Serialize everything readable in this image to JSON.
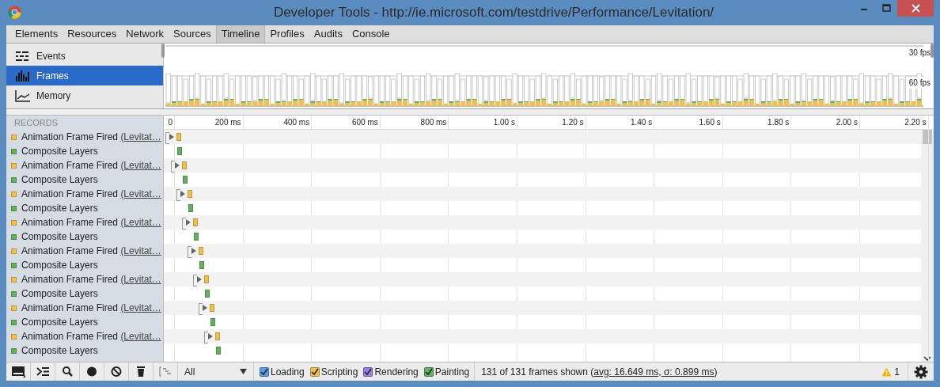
{
  "window": {
    "title": "Developer Tools - http://ie.microsoft.com/testdrive/Performance/Levitation/"
  },
  "tabs": [
    {
      "label": "Elements",
      "selected": false
    },
    {
      "label": "Resources",
      "selected": false
    },
    {
      "label": "Network",
      "selected": false
    },
    {
      "label": "Sources",
      "selected": false
    },
    {
      "label": "Timeline",
      "selected": true
    },
    {
      "label": "Profiles",
      "selected": false
    },
    {
      "label": "Audits",
      "selected": false
    },
    {
      "label": "Console",
      "selected": false
    }
  ],
  "overview_modes": [
    {
      "kind": "events",
      "label": "Events",
      "selected": false
    },
    {
      "kind": "frames",
      "label": "Frames",
      "selected": true
    },
    {
      "kind": "memory",
      "label": "Memory",
      "selected": false
    }
  ],
  "overview": {
    "labels": [
      "30 fps",
      "60 fps"
    ]
  },
  "records": {
    "header": "RECORDS",
    "ticks": [
      "0",
      "200 ms",
      "400 ms",
      "600 ms",
      "800 ms",
      "1.00 s",
      "1.20 s",
      "1.40 s",
      "1.60 s",
      "1.80 s",
      "2.00 s",
      "2.20 s"
    ],
    "rows": [
      {
        "label": "Animation Frame Fired",
        "link": "(Levitat…",
        "color": "#f0c04a",
        "expanded": false
      },
      {
        "label": "Composite Layers",
        "color": "#64b060"
      },
      {
        "label": "Animation Frame Fired",
        "link": "(Levitat…",
        "color": "#f0c04a",
        "expanded": false
      },
      {
        "label": "Composite Layers",
        "color": "#64b060"
      },
      {
        "label": "Animation Frame Fired",
        "link": "(Levitat…",
        "color": "#f0c04a",
        "expanded": false
      },
      {
        "label": "Composite Layers",
        "color": "#64b060"
      },
      {
        "label": "Animation Frame Fired",
        "link": "(Levitat…",
        "color": "#f0c04a",
        "expanded": false
      },
      {
        "label": "Composite Layers",
        "color": "#64b060"
      },
      {
        "label": "Animation Frame Fired",
        "link": "(Levitat…",
        "color": "#f0c04a",
        "expanded": false
      },
      {
        "label": "Composite Layers",
        "color": "#64b060"
      },
      {
        "label": "Animation Frame Fired",
        "link": "(Levitat…",
        "color": "#f0c04a",
        "expanded": false
      },
      {
        "label": "Composite Layers",
        "color": "#64b060"
      },
      {
        "label": "Animation Frame Fired",
        "link": "(Levitat…",
        "color": "#f0c04a",
        "expanded": false
      },
      {
        "label": "Composite Layers",
        "color": "#64b060"
      },
      {
        "label": "Animation Frame Fired",
        "link": "(Levitat…",
        "color": "#f0c04a",
        "expanded": false
      },
      {
        "label": "Composite Layers",
        "color": "#64b060"
      }
    ]
  },
  "status_bar": {
    "filter": "All",
    "categories": [
      {
        "label": "Loading",
        "checked": true,
        "color": "#5a9ce6"
      },
      {
        "label": "Scripting",
        "checked": true,
        "color": "#f0c04a"
      },
      {
        "label": "Rendering",
        "checked": true,
        "color": "#9b7fe6"
      },
      {
        "label": "Painting",
        "checked": true,
        "color": "#64b060"
      }
    ],
    "summary": "131 of 131 frames shown (",
    "summary_link": "avg: 16.649 ms, σ: 0.899 ms",
    "summary_end": ")",
    "warnings": "1"
  }
}
